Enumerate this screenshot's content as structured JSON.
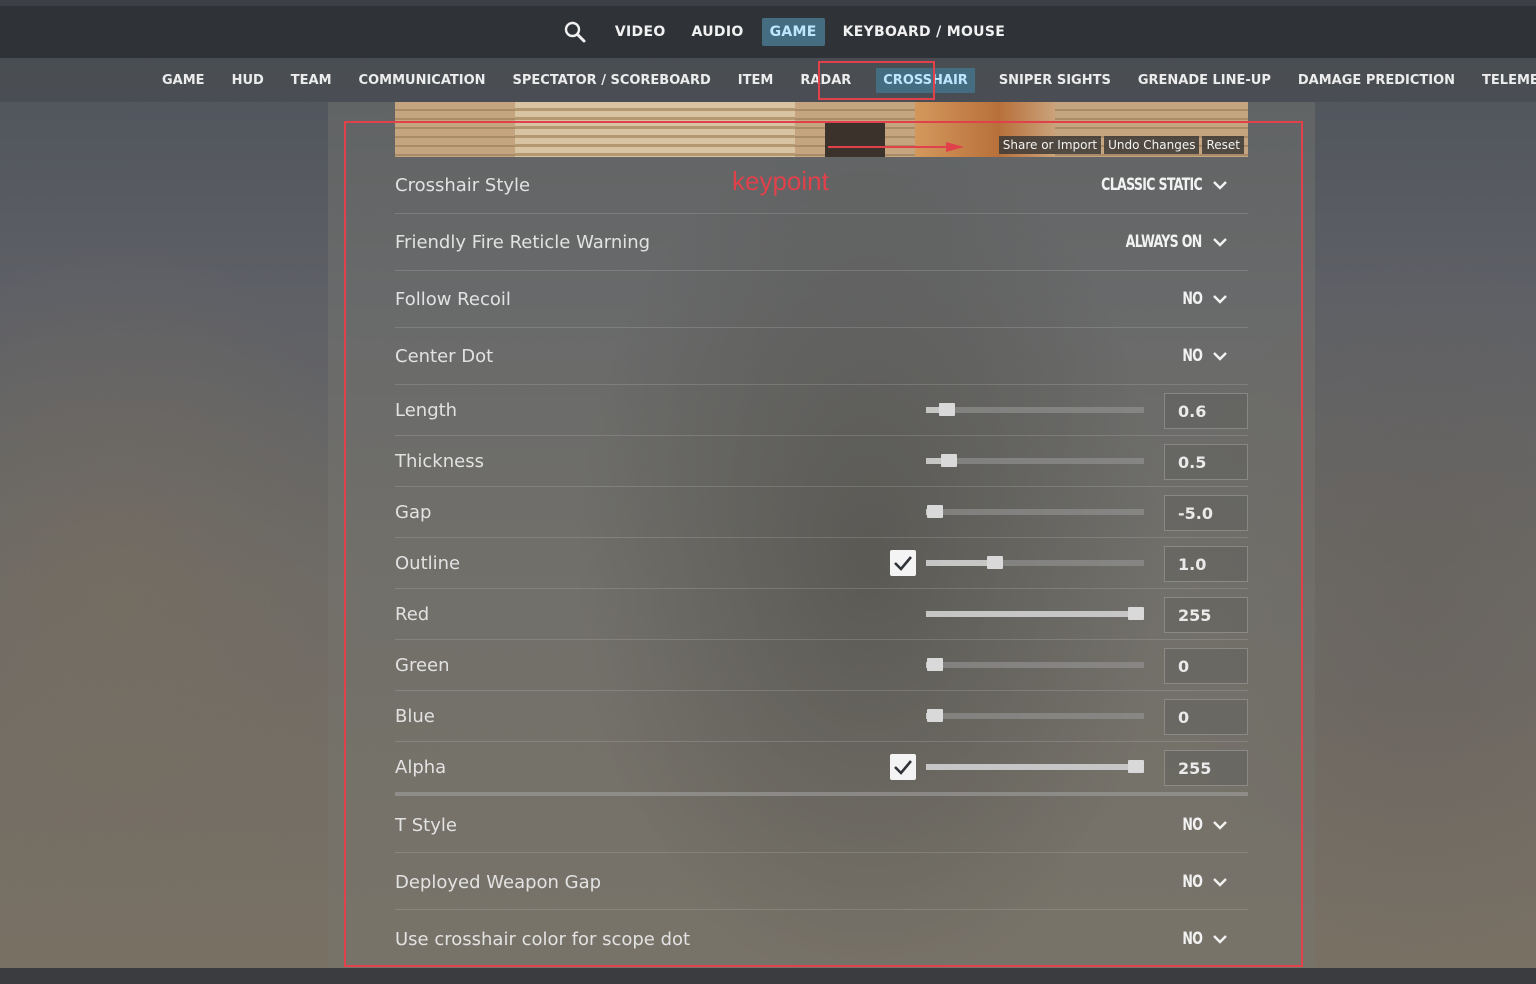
{
  "top_nav": {
    "tabs": [
      {
        "label": "VIDEO"
      },
      {
        "label": "AUDIO"
      },
      {
        "label": "GAME",
        "active": true
      },
      {
        "label": "KEYBOARD / MOUSE"
      }
    ]
  },
  "sub_nav": {
    "tabs": [
      {
        "label": "GAME"
      },
      {
        "label": "HUD"
      },
      {
        "label": "TEAM"
      },
      {
        "label": "COMMUNICATION"
      },
      {
        "label": "SPECTATOR / SCOREBOARD"
      },
      {
        "label": "ITEM"
      },
      {
        "label": "RADAR"
      },
      {
        "label": "CROSSHAIR",
        "active": true
      },
      {
        "label": "SNIPER SIGHTS"
      },
      {
        "label": "GRENADE LINE-UP"
      },
      {
        "label": "DAMAGE PREDICTION"
      },
      {
        "label": "TELEMETRY"
      }
    ]
  },
  "preview": {
    "share_label": "Share or Import",
    "undo_label": "Undo Changes",
    "reset_label": "Reset"
  },
  "annotation": {
    "keypoint_label": "keypoint",
    "color": "#e0414b"
  },
  "settings": {
    "crosshair_style": {
      "label": "Crosshair Style",
      "value": "CLASSIC STATIC"
    },
    "friendly_fire": {
      "label": "Friendly Fire Reticle Warning",
      "value": "ALWAYS ON"
    },
    "follow_recoil": {
      "label": "Follow Recoil",
      "value": "NO"
    },
    "center_dot": {
      "label": "Center Dot",
      "value": "NO"
    },
    "length": {
      "label": "Length",
      "value": "0.6",
      "level": 0.06
    },
    "thickness": {
      "label": "Thickness",
      "value": "0.5",
      "level": 0.07
    },
    "gap": {
      "label": "Gap",
      "value": "-5.0",
      "level": 0.0
    },
    "outline": {
      "label": "Outline",
      "value": "1.0",
      "level": 0.3,
      "checked": true
    },
    "red": {
      "label": "Red",
      "value": "255",
      "level": 1.0
    },
    "green": {
      "label": "Green",
      "value": "0",
      "level": 0.0
    },
    "blue": {
      "label": "Blue",
      "value": "0",
      "level": 0.0
    },
    "alpha": {
      "label": "Alpha",
      "value": "255",
      "level": 1.0,
      "checked": true
    },
    "t_style": {
      "label": "T Style",
      "value": "NO"
    },
    "deployed_weapon_gap": {
      "label": "Deployed Weapon Gap",
      "value": "NO"
    },
    "scope_dot_color": {
      "label": "Use crosshair color for scope dot",
      "value": "NO"
    }
  },
  "colors": {
    "accent_tab_bg": "#456d82",
    "accent_tab_text": "#bfe6ff",
    "highlight": "#e0414b"
  }
}
